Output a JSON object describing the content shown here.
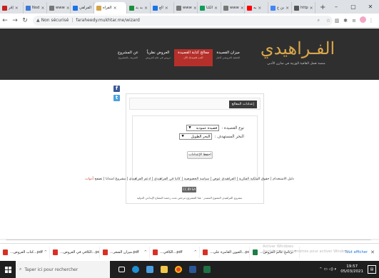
{
  "browser": {
    "tabs": [
      {
        "label": "إقر",
        "icon": "gmail-icon",
        "color": "#c5221f",
        "active": false
      },
      {
        "label": "Nod",
        "icon": "doc-icon",
        "color": "#3c78d8",
        "active": false
      },
      {
        "label": "www",
        "icon": "globe-icon",
        "color": "#777777",
        "active": false
      },
      {
        "label": "الفراهي",
        "icon": "app-icon",
        "color": "#1a73e8",
        "active": false
      },
      {
        "label": "الفراه",
        "icon": "site-icon",
        "color": "#d4a24a",
        "active": true
      },
      {
        "label": "بد بد",
        "icon": "bookmark-icon",
        "color": "#1e8e3e",
        "active": false
      },
      {
        "label": "الع",
        "icon": "app-icon",
        "color": "#1a73e8",
        "active": false
      },
      {
        "label": "www",
        "icon": "globe-icon",
        "color": "#777777",
        "active": false
      },
      {
        "label": "الكتا",
        "icon": "leaf-icon",
        "color": "#0f9d58",
        "active": false
      },
      {
        "label": "www",
        "icon": "globe-icon",
        "color": "#777777",
        "active": false
      },
      {
        "label": "يه",
        "icon": "youtube-icon",
        "color": "#ff0000",
        "active": false
      },
      {
        "label": "بن ع",
        "icon": "google-icon",
        "color": "#4285f4",
        "active": false
      },
      {
        "label": "http",
        "icon": "page-icon",
        "color": "#555555",
        "active": false
      }
    ],
    "security": "Non sécurisé",
    "url": "faraheedy.mukhtar.me/wizard"
  },
  "site": {
    "logo": "الفـراهيدي",
    "tagline": "منصة تعمل القافية الوزنية في منارن الأدبي",
    "menu": [
      {
        "label": "ميزان القصيدة",
        "sub": "العملية العروضي كامل",
        "active": false
      },
      {
        "label": "معالج كتابة القصيدة",
        "sub": "اكتب قصيدتك الآن",
        "active": true
      },
      {
        "label": "العروض نظرياً",
        "sub": "دروس في علم العروض",
        "active": false
      },
      {
        "label": "عن المشروع",
        "sub": "التعريف بالمشروع",
        "active": false
      }
    ],
    "social": {
      "facebook": "f",
      "twitter": "t"
    }
  },
  "panel": {
    "title": "إعدادات المعالج",
    "poem_type_label": "نوع القصيدة :",
    "poem_type_value": "قصيدة عمودية",
    "meter_label": "البحر المستهدف :",
    "meter_value": "البحر الطويل",
    "save_label": "احفظ الإعدادات"
  },
  "footer": {
    "links": "دليل الاستخدام | حقوق الملكية الفكرية | الفراهيدي عوض | سياسة الخصوصية | كاتبا في الفراهيدي | ادعم الفراهيدي | مشروع امتدانا | تصفح",
    "accent_link": "أدوات",
    "badge": "CC BY-SA",
    "note": "مشروع الفراهيدي المفتوح المصدر · هذا المشروع مرخص تحت رخصة المشاع الإبداعي الدولية"
  },
  "watermark": {
    "line1": "Activer Windows",
    "line2": "Accédez aux paramètres pour activer Windows."
  },
  "downloads": {
    "items": [
      {
        "label": "...كتاب العروض...pdf",
        "kind": "pdf"
      },
      {
        "label": "...الكافي في العروض...pdf",
        "kind": "pdf"
      },
      {
        "label": "...ميزان الشعر.pdf",
        "kind": "pdf"
      },
      {
        "label": "...الكافي...pdf",
        "kind": "pdf"
      },
      {
        "label": "...العيون الغامزة على...pdf",
        "kind": "pdf"
      },
      {
        "label": "...برنامج عالم العروض",
        "kind": "xls"
      }
    ],
    "show_all": "Tout afficher"
  },
  "taskbar": {
    "search_placeholder": "Taper ici pour rechercher",
    "time": "19:57",
    "date": "05/03/2021"
  }
}
